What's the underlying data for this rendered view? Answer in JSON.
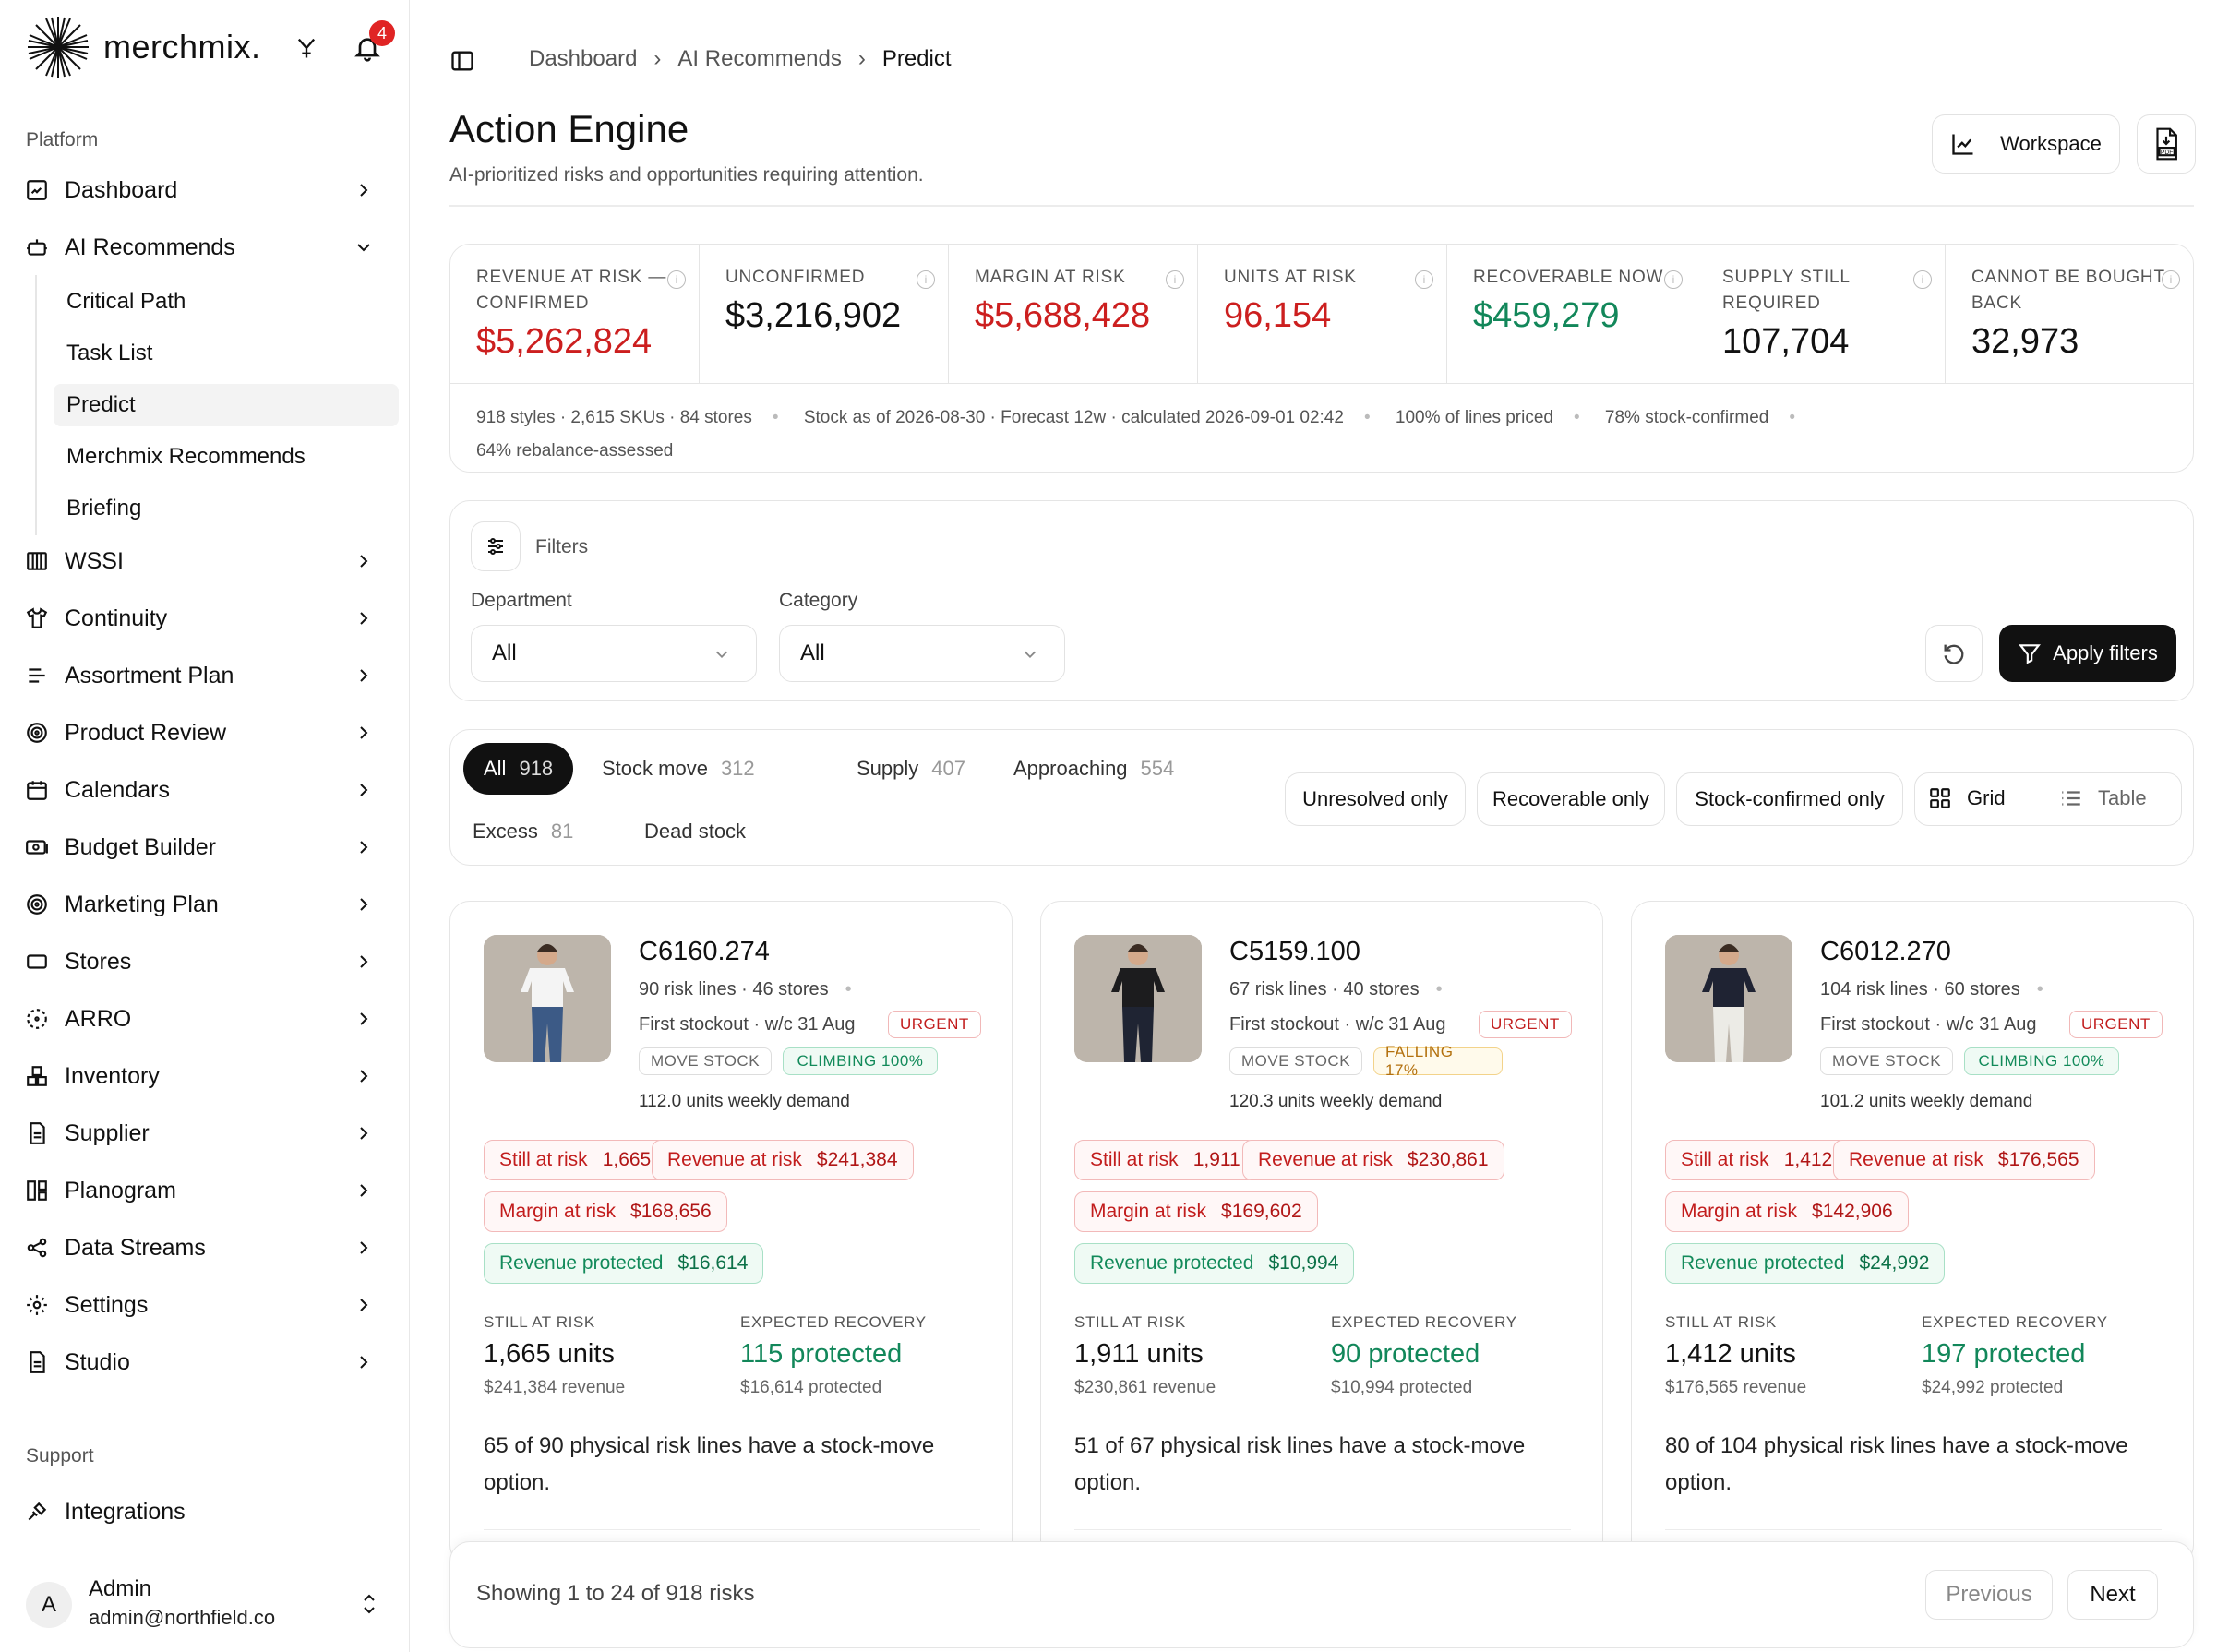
{
  "app": {
    "name": "merchmix.",
    "notifications": "4"
  },
  "sidebar": {
    "platform_label": "Platform",
    "items": [
      {
        "label": "Dashboard",
        "icon": "dashboard-icon"
      },
      {
        "label": "AI Recommends",
        "icon": "ai-icon"
      },
      {
        "label": "WSSI",
        "icon": "columns-icon"
      },
      {
        "label": "Continuity",
        "icon": "shirt-icon"
      },
      {
        "label": "Assortment Plan",
        "icon": "list-icon"
      },
      {
        "label": "Product Review",
        "icon": "target-icon"
      },
      {
        "label": "Calendars",
        "icon": "calendar-icon"
      },
      {
        "label": "Budget Builder",
        "icon": "budget-icon"
      },
      {
        "label": "Marketing Plan",
        "icon": "target-icon"
      },
      {
        "label": "Stores",
        "icon": "store-icon"
      },
      {
        "label": "ARRO",
        "icon": "dashed-circle-icon"
      },
      {
        "label": "Inventory",
        "icon": "boxes-icon"
      },
      {
        "label": "Supplier",
        "icon": "doc-icon"
      },
      {
        "label": "Planogram",
        "icon": "planogram-icon"
      },
      {
        "label": "Data Streams",
        "icon": "share-icon"
      },
      {
        "label": "Settings",
        "icon": "gear-icon"
      },
      {
        "label": "Studio",
        "icon": "doc-icon"
      }
    ],
    "sub_items": [
      "Critical Path",
      "Task List",
      "Predict",
      "Merchmix Recommends",
      "Briefing"
    ],
    "support_label": "Support",
    "integrations": "Integrations",
    "user": {
      "initial": "A",
      "name": "Admin",
      "email": "admin@northfield.co"
    }
  },
  "breadcrumb": [
    "Dashboard",
    "AI Recommends",
    "Predict"
  ],
  "page": {
    "title": "Action Engine",
    "subtitle": "AI-prioritized risks and opportunities requiring attention.",
    "workspace": "Workspace"
  },
  "metrics": [
    {
      "label": "REVENUE AT RISK — CONFIRMED",
      "value": "$5,262,824",
      "color": "#cc1f1f"
    },
    {
      "label": "UNCONFIRMED",
      "value": "$3,216,902",
      "color": "#111111"
    },
    {
      "label": "MARGIN AT RISK",
      "value": "$5,688,428",
      "color": "#cc1f1f"
    },
    {
      "label": "UNITS AT RISK",
      "value": "96,154",
      "color": "#cc1f1f"
    },
    {
      "label": "RECOVERABLE NOW",
      "value": "$459,279",
      "color": "#12875a"
    },
    {
      "label": "SUPPLY STILL REQUIRED",
      "value": "107,704",
      "color": "#111111"
    },
    {
      "label": "CANNOT BE BOUGHT BACK",
      "value": "32,973",
      "color": "#111111"
    }
  ],
  "status": {
    "s1": "918 styles · 2,615 SKUs · 84 stores",
    "s2": "Stock as of 2026-08-30 · Forecast 12w · calculated 2026-09-01 02:42",
    "s3": "100% of lines priced",
    "s4": "78% stock-confirmed",
    "s5": "64% rebalance-assessed"
  },
  "filters": {
    "title": "Filters",
    "department_label": "Department",
    "department_value": "All",
    "category_label": "Category",
    "category_value": "All",
    "apply": "Apply filters"
  },
  "tabs": [
    {
      "label": "All",
      "count": "918"
    },
    {
      "label": "Stock move",
      "count": "312"
    },
    {
      "label": "Supply",
      "count": "407"
    },
    {
      "label": "Approaching",
      "count": "554"
    },
    {
      "label": "Excess",
      "count": "81"
    },
    {
      "label": "Dead stock",
      "count": ""
    }
  ],
  "toggles": {
    "unresolved": "Unresolved only",
    "recoverable": "Recoverable only",
    "stock_confirmed": "Stock-confirmed only",
    "grid": "Grid",
    "table": "Table"
  },
  "cards": [
    {
      "code": "C6160.274",
      "lines": "90 risk lines · 46 stores",
      "stockout": "First stockout · w/c 31 Aug",
      "urgency": "URGENT",
      "action": "MOVE STOCK",
      "trend": "CLIMBING 100%",
      "demand": "112.0 units weekly demand",
      "still_label": "Still at risk",
      "still": "1,665",
      "rev_label": "Revenue at risk",
      "rev": "$241,384",
      "margin_label": "Margin at risk",
      "margin": "$168,656",
      "prot_label": "Revenue protected",
      "prot": "$16,614",
      "sar_label": "STILL AT RISK",
      "sar_units": "1,665 units",
      "sar_rev": "$241,384 revenue",
      "er_label": "EXPECTED RECOVERY",
      "er_val": "115 protected",
      "er_sub": "$16,614 protected",
      "desc": "65 of 90 physical risk lines have a stock-move option."
    },
    {
      "code": "C5159.100",
      "lines": "67 risk lines · 40 stores",
      "stockout": "First stockout · w/c 31 Aug",
      "urgency": "URGENT",
      "action": "MOVE STOCK",
      "trend": "FALLING 17%",
      "demand": "120.3 units weekly demand",
      "still_label": "Still at risk",
      "still": "1,911",
      "rev_label": "Revenue at risk",
      "rev": "$230,861",
      "margin_label": "Margin at risk",
      "margin": "$169,602",
      "prot_label": "Revenue protected",
      "prot": "$10,994",
      "sar_label": "STILL AT RISK",
      "sar_units": "1,911 units",
      "sar_rev": "$230,861 revenue",
      "er_label": "EXPECTED RECOVERY",
      "er_val": "90 protected",
      "er_sub": "$10,994 protected",
      "desc": "51 of 67 physical risk lines have a stock-move option."
    },
    {
      "code": "C6012.270",
      "lines": "104 risk lines · 60 stores",
      "stockout": "First stockout · w/c 31 Aug",
      "urgency": "URGENT",
      "action": "MOVE STOCK",
      "trend": "CLIMBING 100%",
      "demand": "101.2 units weekly demand",
      "still_label": "Still at risk",
      "still": "1,412",
      "rev_label": "Revenue at risk",
      "rev": "$176,565",
      "margin_label": "Margin at risk",
      "margin": "$142,906",
      "prot_label": "Revenue protected",
      "prot": "$24,992",
      "sar_label": "STILL AT RISK",
      "sar_units": "1,412 units",
      "sar_rev": "$176,565 revenue",
      "er_label": "EXPECTED RECOVERY",
      "er_val": "197 protected",
      "er_sub": "$24,992 protected",
      "desc": "80 of 104 physical risk lines have a stock-move option."
    }
  ],
  "pagination": {
    "showing": "Showing 1 to 24 of 918 risks",
    "previous": "Previous",
    "next": "Next"
  }
}
